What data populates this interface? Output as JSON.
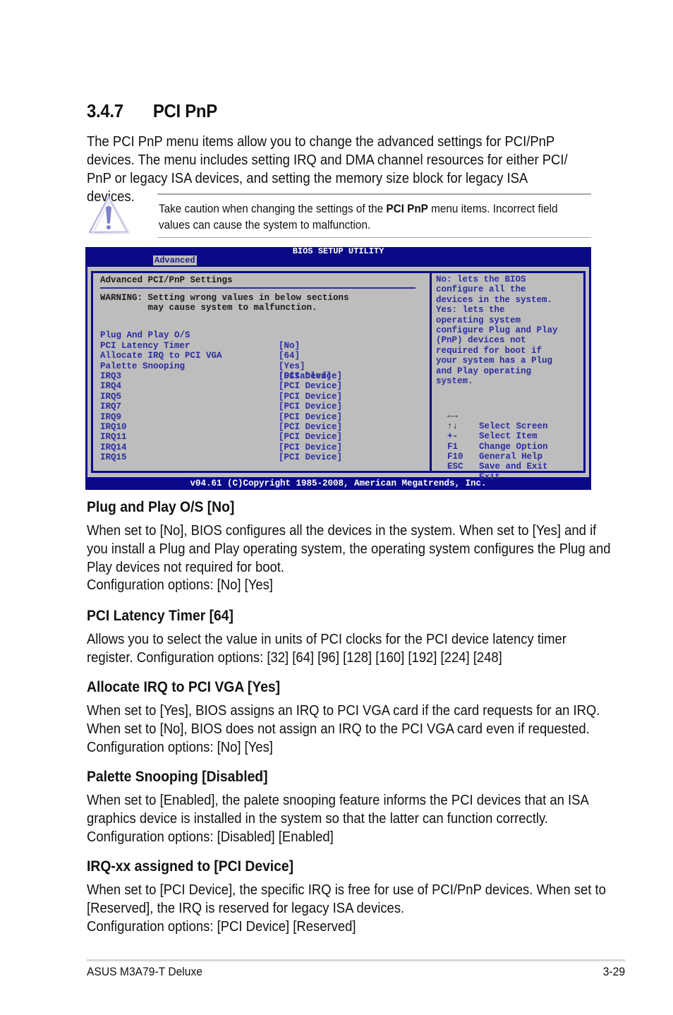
{
  "section": {
    "number": "3.4.7",
    "title": "PCI PnP",
    "intro": "The PCI PnP menu items allow you to change the advanced settings for PCI/PnP devices. The menu includes setting IRQ and DMA channel resources for either PCI/ PnP or legacy ISA devices, and setting the memory size block for legacy ISA devices."
  },
  "caution": {
    "icon": "warning-triangle-icon",
    "text_before": "Take caution when changing the settings of the ",
    "text_bold": "PCI PnP",
    "text_after": " menu items. Incorrect field values can cause the system to malfunction."
  },
  "bios": {
    "title": "BIOS SETUP UTILITY",
    "active_tab": "Advanced",
    "panel_title": "Advanced PCI/PnP Settings",
    "warning_line1": "WARNING: Setting wrong values in below sections",
    "warning_line2": "         may cause system to malfunction.",
    "settings": [
      {
        "label": "Plug And Play O/S",
        "value": "[No]"
      },
      {
        "label": "PCI Latency Timer",
        "value": "[64]"
      },
      {
        "label": "Allocate IRQ to PCI VGA",
        "value": "[Yes]"
      },
      {
        "label": "Palette Snooping",
        "value": "[Disabled]"
      }
    ],
    "irqs": [
      {
        "label": "IRQ3",
        "value": "[PCI Device]"
      },
      {
        "label": "IRQ4",
        "value": "[PCI Device]"
      },
      {
        "label": "IRQ5",
        "value": "[PCI Device]"
      },
      {
        "label": "IRQ7",
        "value": "[PCI Device]"
      },
      {
        "label": "IRQ9",
        "value": "[PCI Device]"
      },
      {
        "label": "IRQ10",
        "value": "[PCI Device]"
      },
      {
        "label": "IRQ11",
        "value": "[PCI Device]"
      },
      {
        "label": "IRQ14",
        "value": "[PCI Device]"
      },
      {
        "label": "IRQ15",
        "value": "[PCI Device]"
      }
    ],
    "help_lines": [
      "No: lets the BIOS",
      "configure all the",
      "devices in the system.",
      "Yes: lets the",
      "operating system",
      "configure Plug and Play",
      "(PnP) devices not",
      "required for boot if",
      "your system has a Plug",
      "and Play operating",
      "system."
    ],
    "keys": [
      {
        "key": "←→",
        "desc": "Select Screen"
      },
      {
        "key": "↑↓",
        "desc": "Select Item"
      },
      {
        "key": "+-",
        "desc": "Change Option"
      },
      {
        "key": "F1",
        "desc": "General Help"
      },
      {
        "key": "F10",
        "desc": "Save and Exit"
      },
      {
        "key": "ESC",
        "desc": "Exit"
      }
    ],
    "footer": "v04.61 (C)Copyright 1985-2008, American Megatrends, Inc.",
    "colors": {
      "background": "#0a0a88",
      "panel": "#bdbdbd",
      "item_text": "#2c2ca0"
    }
  },
  "descriptions": [
    {
      "heading": "Plug and Play O/S [No]",
      "body": "When set to [No], BIOS configures all the devices in the system. When set to [Yes] and if you install a Plug and Play operating system, the operating system configures the Plug and Play devices not required for boot.",
      "options": "Configuration options: [No] [Yes]"
    },
    {
      "heading": "PCI Latency Timer [64]",
      "body": "Allows you to select the value in units of PCI clocks for the PCI device latency timer register. Configuration options: [32] [64] [96] [128] [160] [192] [224] [248]",
      "options": ""
    },
    {
      "heading": "Allocate IRQ to PCI VGA [Yes]",
      "body": "When set to [Yes], BIOS assigns an IRQ to PCI VGA card if the card requests for an IRQ. When set to [No], BIOS does not assign an IRQ to the PCI VGA card even if requested.  Configuration options: [No] [Yes]",
      "options": ""
    },
    {
      "heading": "Palette Snooping [Disabled]",
      "body": "When set to [Enabled], the palete snooping feature informs the PCI devices that an ISA graphics device is installed in the system so that the latter can function correctly. Configuration options: [Disabled] [Enabled]",
      "options": ""
    },
    {
      "heading": "IRQ-xx assigned to [PCI Device]",
      "body": "When set to [PCI Device], the specific IRQ is free for use of PCI/PnP devices. When set to [Reserved], the IRQ is reserved for legacy ISA devices.",
      "options": "Configuration options: [PCI Device] [Reserved]"
    }
  ],
  "page_footer": {
    "product": "ASUS M3A79-T Deluxe",
    "page_number": "3-29"
  }
}
